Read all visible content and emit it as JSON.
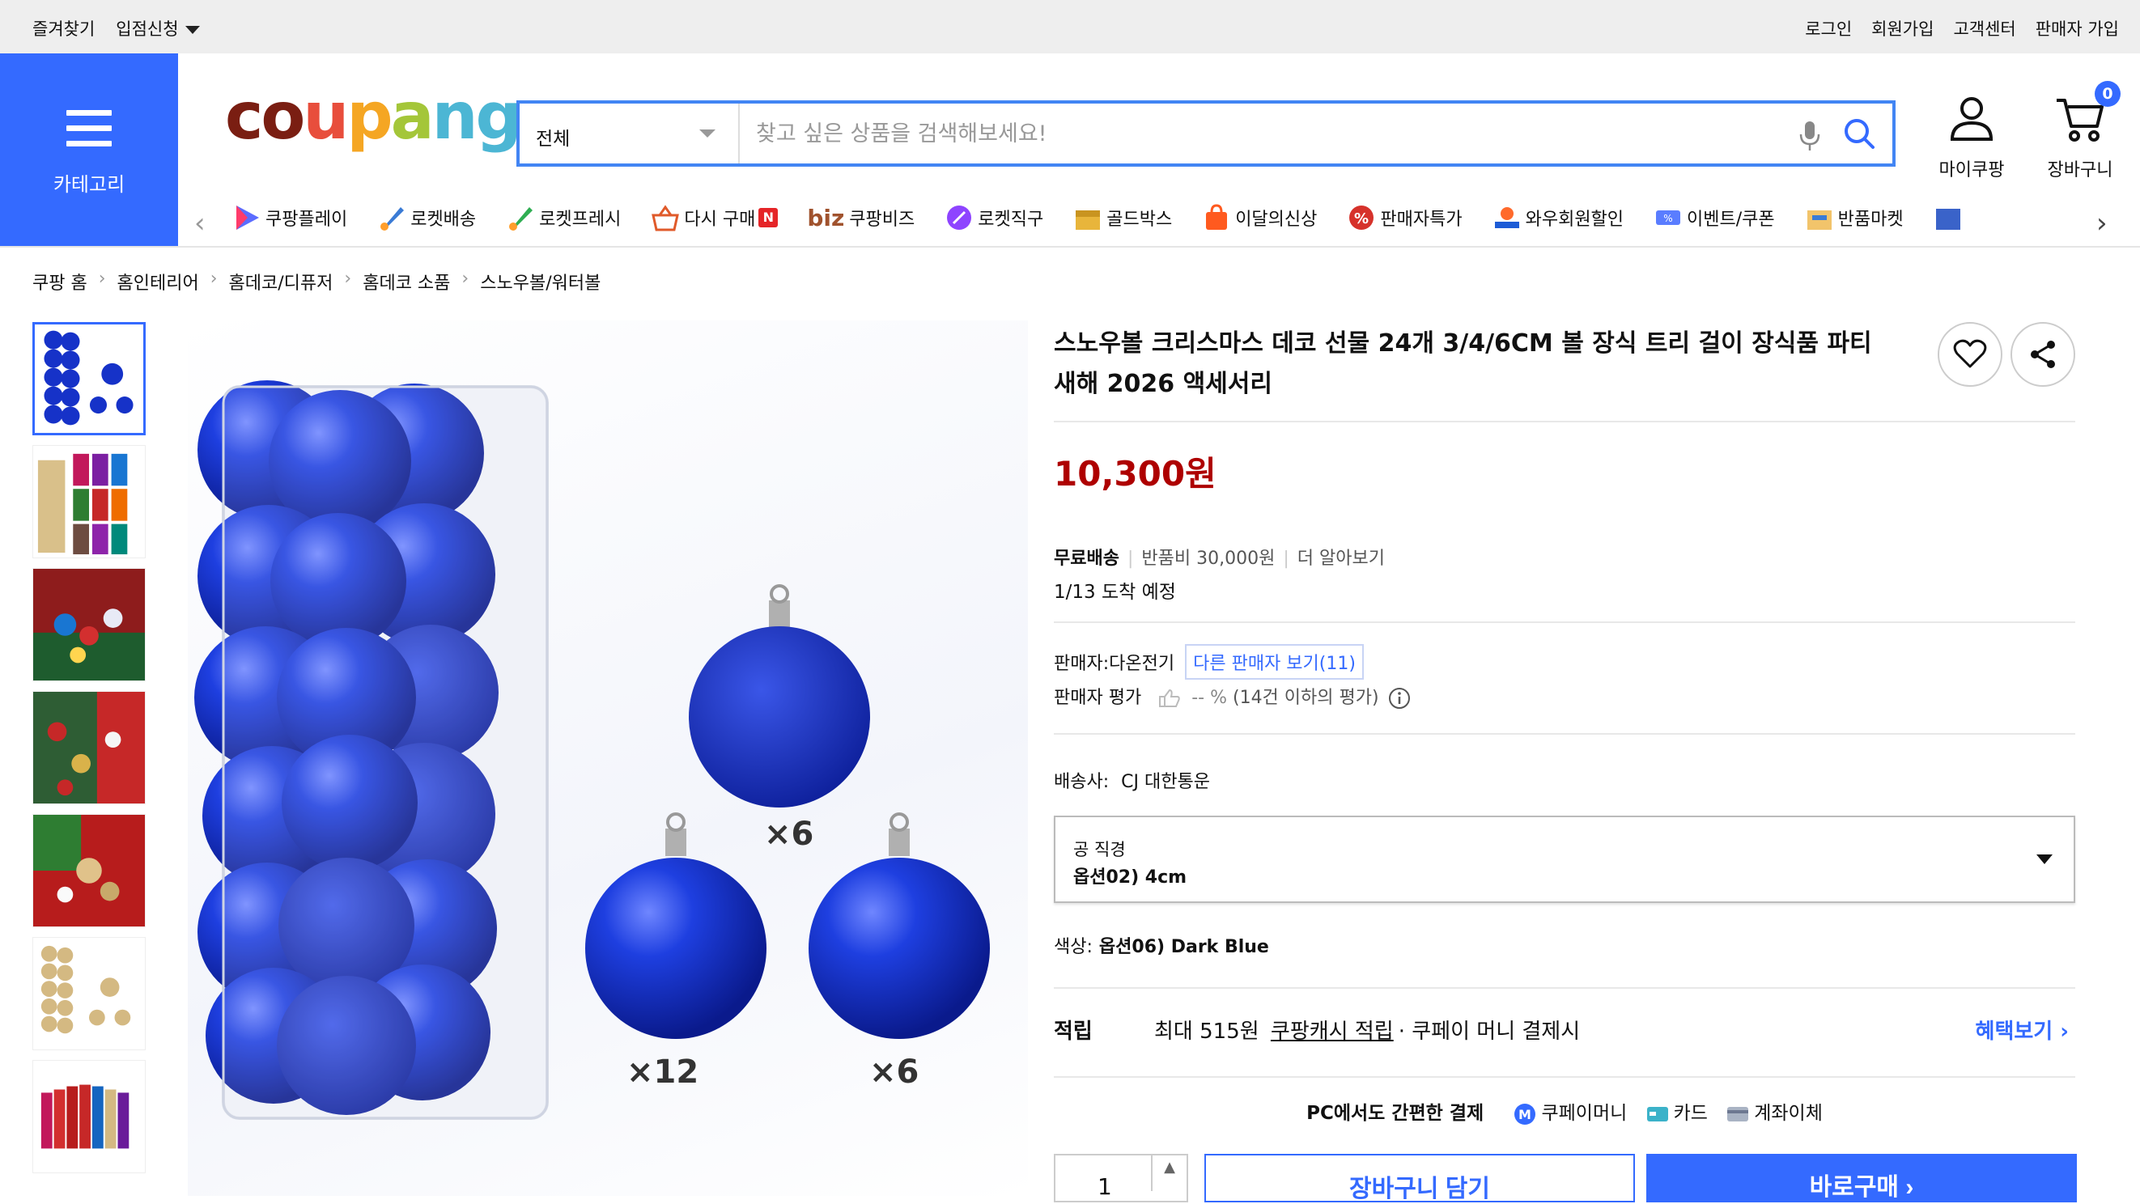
{
  "topbar": {
    "left": [
      "즐겨찾기",
      "입점신청"
    ],
    "right": [
      "로그인",
      "회원가입",
      "고객센터",
      "판매자 가입"
    ]
  },
  "header": {
    "category_label": "카테고리",
    "logo": "coupang",
    "search_category": "전체",
    "search_placeholder": "찾고 싶은 상품을 검색해보세요!",
    "mycoupang": "마이쿠팡",
    "cart": "장바구니",
    "cart_count": "0"
  },
  "nav": {
    "items": [
      "쿠팡플레이",
      "로켓배송",
      "로켓프레시",
      "다시 구매",
      "쿠팡비즈",
      "로켓직구",
      "골드박스",
      "이달의신상",
      "판매자특가",
      "와우회원할인",
      "이벤트/쿠폰",
      "반품마켓"
    ],
    "biz_prefix": "biz",
    "new_badge": "N"
  },
  "breadcrumb": [
    "쿠팡 홈",
    "홈인테리어",
    "홈데코/디퓨저",
    "홈데코 소품",
    "스노우볼/워터볼"
  ],
  "product": {
    "title": "스노우볼 크리스마스 데코 선물 24개 3/4/6CM 볼 장식 트리 걸이 장식품 파티 새해 2026 액세서리",
    "price": "10,300원",
    "shipping_label": "무료배송",
    "return_fee": "반품비 30,000원",
    "learn_more": "더 알아보기",
    "arrival": "1/13 도착 예정",
    "seller_label": "판매자:",
    "seller_name": "다온전기",
    "other_sellers": "다른 판매자 보기(11)",
    "rating_label": "판매자 평가",
    "rating_value": "-- %",
    "rating_note": "(14건 이하의 평가)",
    "courier_label": "배송사:",
    "courier_name": "CJ 대한통운",
    "option_label": "공 직경",
    "option_value": "옵션02) 4cm",
    "color_label": "색상:",
    "color_value": "옵션06) Dark Blue",
    "points_label": "적립",
    "points_text": "최대 515원",
    "points_link": "쿠팡캐시 적립",
    "points_suffix": "· 쿠페이 머니 결제시",
    "benefits": "혜택보기",
    "pay_title": "PC에서도 간편한 결제",
    "pay_methods": [
      "쿠페이머니",
      "카드",
      "계좌이체"
    ],
    "quantity": "1",
    "add_to_cart": "장바구니 담기",
    "buy_now": "바로구매"
  },
  "image_labels": [
    "×6",
    "×12",
    "×6"
  ],
  "colors": {
    "brand_blue": "#346aff",
    "price_red": "#ae0000",
    "ornament_blue": "#1632c8"
  }
}
